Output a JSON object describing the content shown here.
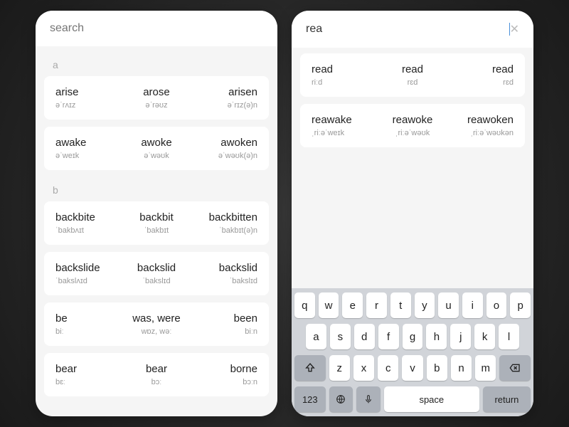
{
  "left": {
    "search_placeholder": "search",
    "sections": [
      {
        "letter": "a",
        "rows": [
          {
            "base": {
              "w": "arise",
              "p": "əˈrʌɪz"
            },
            "past": {
              "w": "arose",
              "p": "əˈrəʊz"
            },
            "pp": {
              "w": "arisen",
              "p": "əˈrɪz(ə)n"
            }
          },
          {
            "base": {
              "w": "awake",
              "p": "əˈweɪk"
            },
            "past": {
              "w": "awoke",
              "p": "əˈwəʊk"
            },
            "pp": {
              "w": "awoken",
              "p": "əˈwəʊk(ə)n"
            }
          }
        ]
      },
      {
        "letter": "b",
        "rows": [
          {
            "base": {
              "w": "backbite",
              "p": "ˈbakbʌɪt"
            },
            "past": {
              "w": "backbit",
              "p": "ˈbakbɪt"
            },
            "pp": {
              "w": "backbitten",
              "p": "ˈbakbɪt(ə)n"
            }
          },
          {
            "base": {
              "w": "backslide",
              "p": "ˈbakslʌɪd"
            },
            "past": {
              "w": "backslid",
              "p": "ˈbakslɪd"
            },
            "pp": {
              "w": "backslid",
              "p": "ˈbakslɪd"
            }
          },
          {
            "base": {
              "w": "be",
              "p": "biː"
            },
            "past": {
              "w": "was, were",
              "p": "wɒz, wəː"
            },
            "pp": {
              "w": "been",
              "p": "biːn"
            }
          },
          {
            "base": {
              "w": "bear",
              "p": "bɛː"
            },
            "past": {
              "w": "bear",
              "p": "bɔː"
            },
            "pp": {
              "w": "borne",
              "p": "bɔːn"
            }
          }
        ]
      }
    ]
  },
  "right": {
    "search_value": "rea",
    "rows": [
      {
        "base": {
          "w": "read",
          "p": "riːd"
        },
        "past": {
          "w": "read",
          "p": "rɛd"
        },
        "pp": {
          "w": "read",
          "p": "rɛd"
        }
      },
      {
        "base": {
          "w": "reawake",
          "p": "ˌriːəˈweɪk"
        },
        "past": {
          "w": "reawoke",
          "p": "ˌriːəˈwəʊk"
        },
        "pp": {
          "w": "reawoken",
          "p": "ˌriːəˈwəʊkən"
        }
      }
    ]
  },
  "keyboard": {
    "row1": [
      "q",
      "w",
      "e",
      "r",
      "t",
      "y",
      "u",
      "i",
      "o",
      "p"
    ],
    "row2": [
      "a",
      "s",
      "d",
      "f",
      "g",
      "h",
      "j",
      "k",
      "l"
    ],
    "row3": [
      "z",
      "x",
      "c",
      "v",
      "b",
      "n",
      "m"
    ],
    "num": "123",
    "space": "space",
    "return": "return"
  }
}
